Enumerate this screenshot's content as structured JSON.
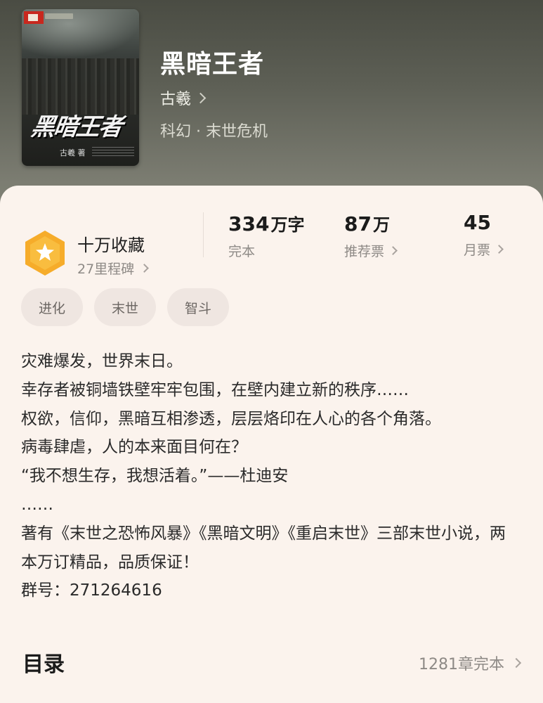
{
  "book": {
    "title": "黑暗王者",
    "author": "古羲",
    "genre": "科幻 · 末世危机",
    "cover": {
      "title_art": "黑暗王者",
      "author_line": "古羲 著"
    }
  },
  "milestone": {
    "title": "十万收藏",
    "subtitle": "27里程碑",
    "icon": "star-badge-icon",
    "color": "#f6ac2a"
  },
  "stats": [
    {
      "value": "334",
      "unit": "万字",
      "label": "完本",
      "has_link": false
    },
    {
      "value": "87",
      "unit": "万",
      "label": "推荐票",
      "has_link": true
    },
    {
      "value": "45",
      "unit": "",
      "label": "月票",
      "has_link": true
    }
  ],
  "tags": [
    "进化",
    "末世",
    "智斗"
  ],
  "description": [
    "灾难爆发，世界末日。",
    "幸存者被铜墙铁壁牢牢包围，在壁内建立新的秩序……",
    "权欲，信仰，黑暗互相渗透，层层烙印在人心的各个角落。",
    "病毒肆虐，人的本来面目何在？",
    "“我不想生存，我想活着。”——杜迪安",
    "……",
    "著有《末世之恐怖风暴》《黑暗文明》《重启末世》三部末世小说，两本万订精品，品质保证！",
    "群号：271264616"
  ],
  "toc": {
    "title": "目录",
    "info": "1281章完本"
  }
}
